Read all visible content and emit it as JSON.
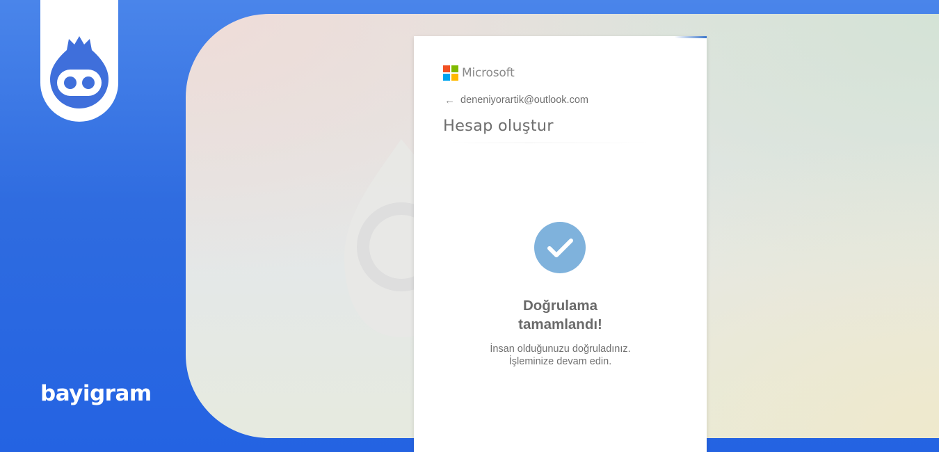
{
  "brand": {
    "logo_icon": "bayigram-drop-icon",
    "wordmark": "bayigram",
    "colors": {
      "background_blue": "#2f6ce0",
      "logo_blue": "#3f6fdb"
    }
  },
  "card": {
    "provider_logo_text": "Microsoft",
    "logo_colors": [
      "#f25022",
      "#7fba00",
      "#00a4ef",
      "#ffb900"
    ],
    "back_icon": "arrow-left-icon",
    "back_arrow": "←",
    "identity_email": "deneniyorartik@outlook.com",
    "title": "Hesap oluştur",
    "status_icon": "checkmark-circle-icon",
    "status_color": "#7fb2dc",
    "verify_title_line1": "Doğrulama",
    "verify_title_line2": "tamamlandı!",
    "verify_desc_line1": "İnsan olduğunuzu doğruladınız.",
    "verify_desc_line2": "İşleminize devam edin."
  }
}
